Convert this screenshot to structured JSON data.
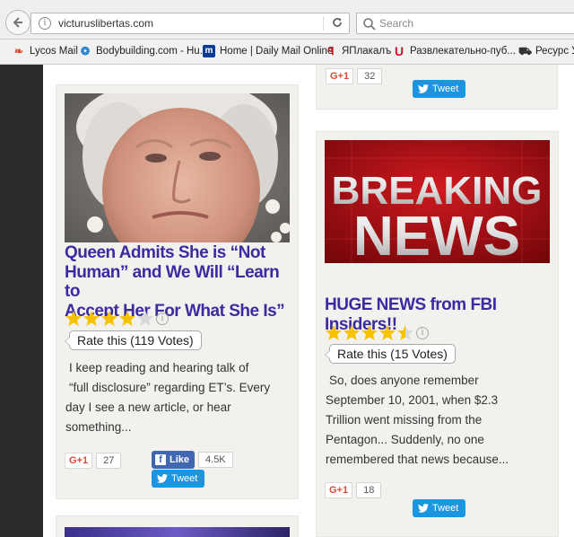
{
  "browser": {
    "url": "victuruslibertas.com",
    "search_placeholder": "Search",
    "bookmarks": [
      {
        "label": "Lycos Mail"
      },
      {
        "label": "Bodybuilding.com - Hu..."
      },
      {
        "label": "Home | Daily Mail Online"
      },
      {
        "label": "ЯПлакалъ"
      },
      {
        "label": "Развлекательно-пуб..."
      },
      {
        "label": "Ресурс У"
      }
    ]
  },
  "top_right_card": {
    "gplus_count": "32",
    "tweet_label": "Tweet"
  },
  "cards": [
    {
      "title_lines": [
        "Queen Admits She is “Not",
        "Human” and We Will “Learn to",
        "Accept Her For What She Is”"
      ],
      "rating": 4,
      "rating_max": 5,
      "rate_text": "Rate this (119 Votes)",
      "excerpt_lines": [
        "I keep reading and hearing talk of",
        "“full disclosure” regarding ET’s.  Every",
        "day I see a new article, or hear",
        "something..."
      ],
      "gplus_count": "27",
      "like_label": "Like",
      "like_count": "4.5K",
      "tweet_label": "Tweet"
    },
    {
      "image_text": [
        "BREAKING",
        "NEWS"
      ],
      "title_lines": [
        "HUGE NEWS from FBI Insiders!!"
      ],
      "rating": 4.5,
      "rating_max": 5,
      "rate_text": "Rate this (15 Votes)",
      "excerpt_lines": [
        "So, does anyone remember",
        "September 10, 2001, when $2.3",
        "Trillion went missing from the",
        "Pentagon...  Suddenly, no one",
        "remembered that news because..."
      ],
      "gplus_count": "18",
      "tweet_label": "Tweet"
    }
  ],
  "labels": {
    "gplus": "G+1"
  }
}
